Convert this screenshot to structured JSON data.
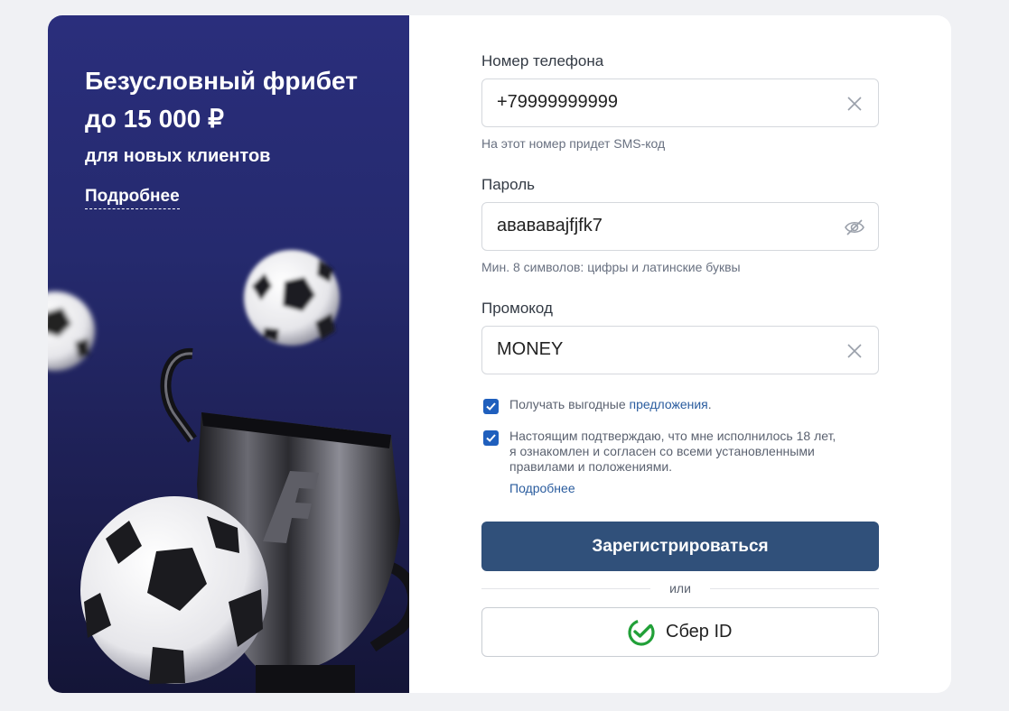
{
  "promo": {
    "title": "Безусловный фрибет до 15 000 ₽",
    "subtitle": "для новых клиентов",
    "more_link": "Подробнее"
  },
  "form": {
    "phone": {
      "label": "Номер телефона",
      "value": "+79999999999",
      "hint": "На этот номер придет SMS-код",
      "icon": "clear-icon"
    },
    "password": {
      "label": "Пароль",
      "value": "авававаjfjfk7",
      "hint": "Мин. 8 символов: цифры и латинские буквы",
      "icon": "eye-off-icon"
    },
    "promo_code": {
      "label": "Промокод",
      "value": "MONEY",
      "icon": "clear-icon"
    },
    "offers_checkbox": {
      "checked": true,
      "text": "Получать выгодные ",
      "link": "предложения",
      "suffix": "."
    },
    "age_checkbox": {
      "checked": true,
      "line1": "Настоящим подтверждаю, что мне исполнилось 18 лет,",
      "line2": "я ознакомлен и согласен со всеми установленными",
      "line3": "правилами и положениями.",
      "link": "Подробнее"
    },
    "submit_label": "Зарегистрироваться",
    "or_label": "или",
    "sber_label": "Сбер ID"
  },
  "colors": {
    "accent": "#30507a",
    "checkbox": "#1f5fbd",
    "link": "#2a5c9e",
    "sber_green": "#21a038",
    "promo_bg": "#252a6e"
  }
}
